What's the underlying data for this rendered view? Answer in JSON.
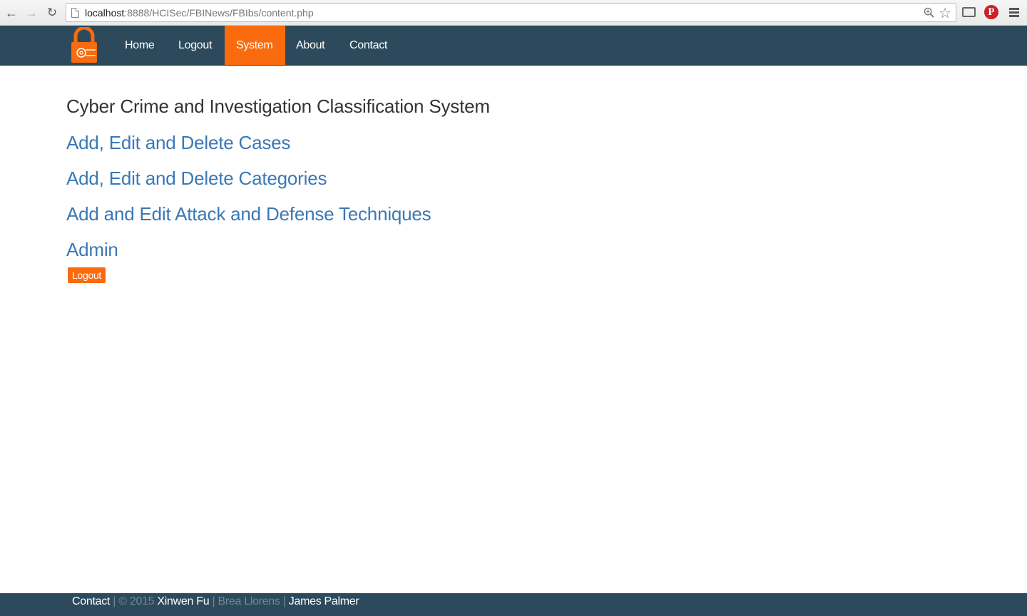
{
  "browser": {
    "url_host": "localhost",
    "url_rest": ":8888/HCISec/FBINews/FBIbs/content.php"
  },
  "nav": {
    "items": [
      {
        "label": "Home",
        "active": false
      },
      {
        "label": "Logout",
        "active": false
      },
      {
        "label": "System",
        "active": true
      },
      {
        "label": "About",
        "active": false
      },
      {
        "label": "Contact",
        "active": false
      }
    ]
  },
  "main": {
    "title": "Cyber Crime and Investigation Classification System",
    "links": [
      "Add, Edit and Delete Cases",
      "Add, Edit and Delete Categories",
      "Add and Edit Attack and Defense Techniques",
      "Admin"
    ],
    "logout_button": "Logout"
  },
  "footer": {
    "contact": "Contact",
    "sep": "|",
    "copyright": "© 2015",
    "author1": "Xinwen Fu",
    "author2": "Brea Llorens",
    "author3": "James Palmer"
  },
  "colors": {
    "navbar": "#2c4a5b",
    "accent": "#f96b0e",
    "link": "#3a78b5"
  }
}
